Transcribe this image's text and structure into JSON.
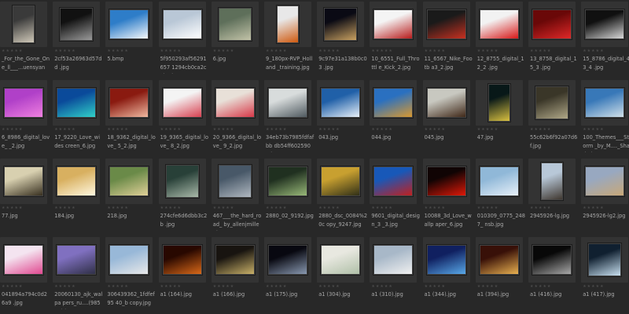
{
  "browser": {
    "rating_glyphs": "★★★★★",
    "items": [
      {
        "name": "_For_the_Gone_One_ll___...uensyan",
        "c1": "#3a3a3a",
        "c2": "#cfc8b8",
        "shape": "portrait"
      },
      {
        "name": "2cf53a26963d57dd .jpg",
        "c1": "#111111",
        "c2": "#9a9a9a",
        "shape": "square"
      },
      {
        "name": "5.bmp",
        "c1": "#2e7dc8",
        "c2": "#f5f8fa",
        "shape": "land"
      },
      {
        "name": "5f950293af56291657 1294cb0ca2c2b2.jpg",
        "c1": "#b9c7d6",
        "c2": "#ffffff",
        "shape": "land"
      },
      {
        "name": "6.jpg",
        "c1": "#5e6f5a",
        "c2": "#c2c3a8",
        "shape": "square"
      },
      {
        "name": "9_180px-RVP_Holland _training.jpg",
        "c1": "#e8e8e8",
        "c2": "#cf5a10",
        "shape": "portrait"
      },
      {
        "name": "9c97e31a138b0c03 .jpg",
        "c1": "#0a0a14",
        "c2": "#c8a060",
        "shape": "square"
      },
      {
        "name": "10_6551_Full_Throttl e_Kick_2.jpg",
        "c1": "#f4f4f4",
        "c2": "#b81c1c",
        "shape": "land"
      },
      {
        "name": "11_6567_Nike_Footb a3_2.jpg",
        "c1": "#1a1a1a",
        "c2": "#c83020",
        "shape": "land"
      },
      {
        "name": "12_8755_digital_12_2 .jpg",
        "c1": "#f2f2f2",
        "c2": "#d81818",
        "shape": "land"
      },
      {
        "name": "13_8758_digital_15_3 .jpg",
        "c1": "#6a0808",
        "c2": "#e02828",
        "shape": "land"
      },
      {
        "name": "15_8786_digital_43_4 .jpg",
        "c1": "#101010",
        "c2": "#d8d8d8",
        "shape": "land"
      },
      {
        "name": "6_8986_digital_love_ _2.jpg",
        "c1": "#b040c8",
        "c2": "#f080e0",
        "shape": "land"
      },
      {
        "name": "17_9220_Love_wides creen_6.jpg",
        "c1": "#0a4a9a",
        "c2": "#30d0c8",
        "shape": "land"
      },
      {
        "name": "18_9362_digital_love_ 5_2.jpg",
        "c1": "#8a1a10",
        "c2": "#f0b8a0",
        "shape": "land"
      },
      {
        "name": "19_9365_digital_love_ 8_2.jpg",
        "c1": "#f4f4f4",
        "c2": "#d84050",
        "shape": "land"
      },
      {
        "name": "20_9366_digital_love_ 9_2.jpg",
        "c1": "#e8e0d8",
        "c2": "#d83848",
        "shape": "land"
      },
      {
        "name": "34eb73b7985fdfafbb db54ff6025908.jpg",
        "c1": "#d8dcdc",
        "c2": "#505a60",
        "shape": "land"
      },
      {
        "name": "043.jpg",
        "c1": "#2060a8",
        "c2": "#e8f0f8",
        "shape": "land"
      },
      {
        "name": "044.jpg",
        "c1": "#2a70c0",
        "c2": "#d89830",
        "shape": "land"
      },
      {
        "name": "045.jpg",
        "c1": "#c8c8c0",
        "c2": "#402818",
        "shape": "land"
      },
      {
        "name": "47.jpg",
        "c1": "#081818",
        "c2": "#d8c040",
        "shape": "portrait"
      },
      {
        "name": "55c62b6f92a07d6f.jpg",
        "c1": "#3a3628",
        "c2": "#b0a888",
        "shape": "square"
      },
      {
        "name": "100_Themes___Storm _by_M...._Shado.jpg",
        "c1": "#3878b8",
        "c2": "#d0e0e8",
        "shape": "land"
      },
      {
        "name": "77.jpg",
        "c1": "#d8d0b0",
        "c2": "#383020",
        "shape": "land"
      },
      {
        "name": "184.jpg",
        "c1": "#d8b060",
        "c2": "#fff8e0",
        "shape": "land"
      },
      {
        "name": "218.jpg",
        "c1": "#6a8a48",
        "c2": "#e0d098",
        "shape": "land"
      },
      {
        "name": "274cfe6d6dbb3c2b .jpg",
        "c1": "#284038",
        "c2": "#a8b8a8",
        "shape": "square"
      },
      {
        "name": "467___the_hard_road_ by_allenjmiller.jpg",
        "c1": "#485868",
        "c2": "#b0b8c0",
        "shape": "square"
      },
      {
        "name": "2880_02_9192.jpg",
        "c1": "#203020",
        "c2": "#98b878",
        "shape": "land"
      },
      {
        "name": "2880_dsc_0084%20c opy_9247.jpg",
        "c1": "#c8a030",
        "c2": "#303018",
        "shape": "land"
      },
      {
        "name": "9601_digital_design_3 _3.jpg",
        "c1": "#1858b8",
        "c2": "#c02020",
        "shape": "land"
      },
      {
        "name": "10088_3d_Love_wallp aper_6.jpg",
        "c1": "#100404",
        "c2": "#e01808",
        "shape": "land"
      },
      {
        "name": "010309_0775_2487_ nsb.jpg",
        "c1": "#90b8d8",
        "c2": "#e8f0f8",
        "shape": "land"
      },
      {
        "name": "2945926-lg.jpg",
        "c1": "#b8c8d8",
        "c2": "#403830",
        "shape": "portrait"
      },
      {
        "name": "2945926-lg2.jpg",
        "c1": "#98a8c0",
        "c2": "#c8a878",
        "shape": "land"
      },
      {
        "name": "041894a794c0d26a9 .jpg",
        "c1": "#f4e4f0",
        "c2": "#e04890",
        "shape": "land"
      },
      {
        "name": "20060130_ajk_walpa pers_ru....(98518).jpg",
        "c1": "#8070c0",
        "c2": "#303048",
        "shape": "land"
      },
      {
        "name": "306439362_1fdfef95 40_b copy.jpg",
        "c1": "#98b8d8",
        "c2": "#e8e8e8",
        "shape": "land"
      },
      {
        "name": "a1 (164).jpg",
        "c1": "#280800",
        "c2": "#d86818",
        "shape": "land"
      },
      {
        "name": "a1 (166).jpg",
        "c1": "#181410",
        "c2": "#c8b068",
        "shape": "land"
      },
      {
        "name": "a1 (175).jpg",
        "c1": "#080810",
        "c2": "#8898b0",
        "shape": "land"
      },
      {
        "name": "a1 (304).jpg",
        "c1": "#e8e8e0",
        "c2": "#b0c0a8",
        "shape": "land"
      },
      {
        "name": "a1 (310).jpg",
        "c1": "#a8b8c8",
        "c2": "#f0f0f0",
        "shape": "land"
      },
      {
        "name": "a1 (344).jpg",
        "c1": "#102060",
        "c2": "#58a8e8",
        "shape": "land"
      },
      {
        "name": "a1 (394).jpg",
        "c1": "#381008",
        "c2": "#e8b050",
        "shape": "land"
      },
      {
        "name": "a1 (416).jpg",
        "c1": "#080808",
        "c2": "#a8a8a8",
        "shape": "land"
      },
      {
        "name": "a1 (417).jpg",
        "c1": "#102030",
        "c2": "#c8e0f0",
        "shape": "square"
      }
    ]
  }
}
